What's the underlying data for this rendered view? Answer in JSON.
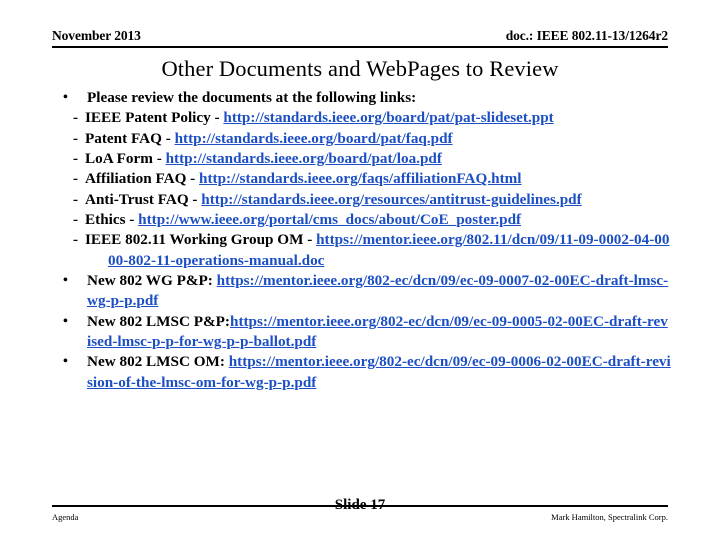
{
  "header": {
    "date": "November 2013",
    "doc_reference": "doc.: IEEE 802.11-13/1264r2"
  },
  "title": "Other Documents and WebPages to Review",
  "body": {
    "bullet_glyph": "•",
    "dash_glyph": "-",
    "link_color": "#1c4fc4",
    "items": [
      {
        "level": 1,
        "label": "Please review the documents at the following links:",
        "link": ""
      },
      {
        "level": 2,
        "label": "IEEE Patent Policy - ",
        "link": "http://standards.ieee.org/board/pat/pat-slideset.ppt"
      },
      {
        "level": 2,
        "label": "Patent FAQ - ",
        "link": "http://standards.ieee.org/board/pat/faq.pdf"
      },
      {
        "level": 2,
        "label": "LoA Form - ",
        "link": "http://standards.ieee.org/board/pat/loa.pdf"
      },
      {
        "level": 2,
        "label": "Affiliation FAQ - ",
        "link": "http://standards.ieee.org/faqs/affiliationFAQ.html"
      },
      {
        "level": 2,
        "label": "Anti-Trust FAQ - ",
        "link": "http://standards.ieee.org/resources/antitrust-guidelines.pdf"
      },
      {
        "level": 2,
        "label": "Ethics - ",
        "link": "http://www.ieee.org/portal/cms_docs/about/CoE_poster.pdf"
      },
      {
        "level": 2,
        "label": "IEEE 802.11 Working Group OM - ",
        "link": "https://mentor.ieee.org/802.11/dcn/09/11-09-0002-04-0000-802-11-operations-manual.doc"
      },
      {
        "level": 1,
        "label": "New 802 WG P&P: ",
        "link": "https://mentor.ieee.org/802-ec/dcn/09/ec-09-0007-02-00EC-draft-lmsc-wg-p-p.pdf"
      },
      {
        "level": 1,
        "label": "New 802 LMSC P&P:",
        "link": "https://mentor.ieee.org/802-ec/dcn/09/ec-09-0005-02-00EC-draft-revised-lmsc-p-p-for-wg-p-p-ballot.pdf"
      },
      {
        "level": 1,
        "label": "New 802 LMSC OM: ",
        "link": "https://mentor.ieee.org/802-ec/dcn/09/ec-09-0006-02-00EC-draft-revision-of-the-lmsc-om-for-wg-p-p.pdf"
      }
    ]
  },
  "footer": {
    "left": "Agenda",
    "center": "Slide 17",
    "right": "Mark Hamilton, Spectralink Corp."
  }
}
